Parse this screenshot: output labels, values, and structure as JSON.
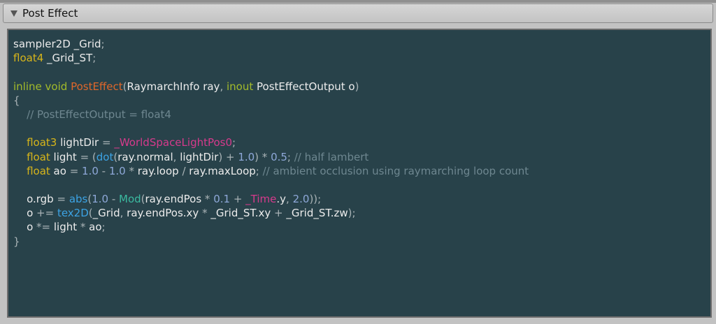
{
  "header": {
    "title": "Post Effect"
  },
  "colors": {
    "background": "#28424a",
    "type": "#d7b51a",
    "keyword": "#a3bb2a",
    "function": "#e0672a",
    "builtin": "#3ca3e4",
    "unity_global": "#d63a8c",
    "number": "#8ea8d8",
    "comment": "#6e8790"
  },
  "code": {
    "lines": [
      [
        {
          "t": "sampler2D _Grid",
          "c": "plain"
        },
        {
          "t": ";",
          "c": "op"
        }
      ],
      [
        {
          "t": "float4",
          "c": "type"
        },
        {
          "t": " _Grid_ST",
          "c": "plain"
        },
        {
          "t": ";",
          "c": "op"
        }
      ],
      [],
      [
        {
          "t": "inline",
          "c": "kw"
        },
        {
          "t": " ",
          "c": "plain"
        },
        {
          "t": "void",
          "c": "kw"
        },
        {
          "t": " ",
          "c": "plain"
        },
        {
          "t": "PostEffect",
          "c": "fn"
        },
        {
          "t": "(",
          "c": "op"
        },
        {
          "t": "RaymarchInfo ray",
          "c": "plain"
        },
        {
          "t": ", ",
          "c": "op"
        },
        {
          "t": "inout",
          "c": "kw"
        },
        {
          "t": " PostEffectOutput o",
          "c": "plain"
        },
        {
          "t": ")",
          "c": "op"
        }
      ],
      [
        {
          "t": "{",
          "c": "brace"
        }
      ],
      [
        {
          "t": "    // PostEffectOutput = float4",
          "c": "comment"
        }
      ],
      [],
      [
        {
          "t": "    ",
          "c": "plain"
        },
        {
          "t": "float3",
          "c": "type"
        },
        {
          "t": " lightDir ",
          "c": "plain"
        },
        {
          "t": "= ",
          "c": "op"
        },
        {
          "t": "_WorldSpaceLightPos0",
          "c": "unity"
        },
        {
          "t": ";",
          "c": "op"
        }
      ],
      [
        {
          "t": "    ",
          "c": "plain"
        },
        {
          "t": "float",
          "c": "type"
        },
        {
          "t": " light ",
          "c": "plain"
        },
        {
          "t": "= (",
          "c": "op"
        },
        {
          "t": "dot",
          "c": "builtin"
        },
        {
          "t": "(",
          "c": "op"
        },
        {
          "t": "ray.normal",
          "c": "plain"
        },
        {
          "t": ", ",
          "c": "op"
        },
        {
          "t": "lightDir",
          "c": "plain"
        },
        {
          "t": ") + ",
          "c": "op"
        },
        {
          "t": "1.0",
          "c": "num"
        },
        {
          "t": ") * ",
          "c": "op"
        },
        {
          "t": "0.5",
          "c": "num"
        },
        {
          "t": "; ",
          "c": "op"
        },
        {
          "t": "// half lambert",
          "c": "comment"
        }
      ],
      [
        {
          "t": "    ",
          "c": "plain"
        },
        {
          "t": "float",
          "c": "type"
        },
        {
          "t": " ao ",
          "c": "plain"
        },
        {
          "t": "= ",
          "c": "op"
        },
        {
          "t": "1.0",
          "c": "num"
        },
        {
          "t": " - ",
          "c": "op"
        },
        {
          "t": "1.0",
          "c": "num"
        },
        {
          "t": " * ",
          "c": "op"
        },
        {
          "t": "ray.loop",
          "c": "plain"
        },
        {
          "t": " / ",
          "c": "op"
        },
        {
          "t": "ray.maxLoop",
          "c": "plain"
        },
        {
          "t": "; ",
          "c": "op"
        },
        {
          "t": "// ambient occlusion using raymarching loop count",
          "c": "comment"
        }
      ],
      [],
      [
        {
          "t": "    o.rgb ",
          "c": "plain"
        },
        {
          "t": "= ",
          "c": "op"
        },
        {
          "t": "abs",
          "c": "builtin"
        },
        {
          "t": "(",
          "c": "op"
        },
        {
          "t": "1.0",
          "c": "num"
        },
        {
          "t": " - ",
          "c": "op"
        },
        {
          "t": "Mod",
          "c": "teal"
        },
        {
          "t": "(",
          "c": "op"
        },
        {
          "t": "ray.endPos",
          "c": "plain"
        },
        {
          "t": " * ",
          "c": "op"
        },
        {
          "t": "0.1",
          "c": "num"
        },
        {
          "t": " + ",
          "c": "op"
        },
        {
          "t": "_Time",
          "c": "unity"
        },
        {
          "t": ".y",
          "c": "plain"
        },
        {
          "t": ", ",
          "c": "op"
        },
        {
          "t": "2.0",
          "c": "num"
        },
        {
          "t": "));",
          "c": "op"
        }
      ],
      [
        {
          "t": "    o ",
          "c": "plain"
        },
        {
          "t": "+= ",
          "c": "op"
        },
        {
          "t": "tex2D",
          "c": "builtin"
        },
        {
          "t": "(",
          "c": "op"
        },
        {
          "t": "_Grid",
          "c": "plain"
        },
        {
          "t": ", ",
          "c": "op"
        },
        {
          "t": "ray.endPos.xy",
          "c": "plain"
        },
        {
          "t": " * ",
          "c": "op"
        },
        {
          "t": "_Grid_ST.xy",
          "c": "plain"
        },
        {
          "t": " + ",
          "c": "op"
        },
        {
          "t": "_Grid_ST.zw",
          "c": "plain"
        },
        {
          "t": ");",
          "c": "op"
        }
      ],
      [
        {
          "t": "    o ",
          "c": "plain"
        },
        {
          "t": "*= ",
          "c": "op"
        },
        {
          "t": "light",
          "c": "plain"
        },
        {
          "t": " * ",
          "c": "op"
        },
        {
          "t": "ao",
          "c": "plain"
        },
        {
          "t": ";",
          "c": "op"
        }
      ],
      [
        {
          "t": "}",
          "c": "brace"
        }
      ]
    ]
  }
}
